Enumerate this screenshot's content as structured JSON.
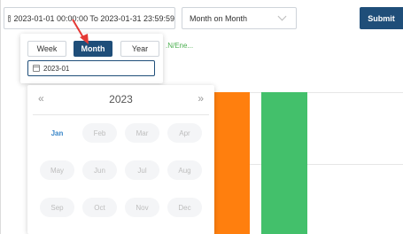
{
  "topbar": {
    "date_range": "2023-01-01 00:00:00 To 2023-01-31 23:59:59",
    "mode_value": "Month on Month",
    "submit_label": "Submit"
  },
  "chart": {
    "legend_fragment": ".N/Ene...",
    "colors": {
      "orange": "#ff7f0e",
      "green": "#43c06b"
    }
  },
  "picker": {
    "tabs": [
      "Week",
      "Month",
      "Year"
    ],
    "selected_tab": "Month",
    "month_value": "2023-01"
  },
  "calendar": {
    "prev": "«",
    "next": "»",
    "year": "2023",
    "months": [
      "Jan",
      "Feb",
      "Mar",
      "Apr",
      "May",
      "Jun",
      "Jul",
      "Aug",
      "Sep",
      "Oct",
      "Nov",
      "Dec"
    ],
    "active_month": "Jan"
  },
  "colors": {
    "primary": "#1f4e79",
    "active_month_text": "#3a86c8",
    "arrow": "#e53935"
  }
}
